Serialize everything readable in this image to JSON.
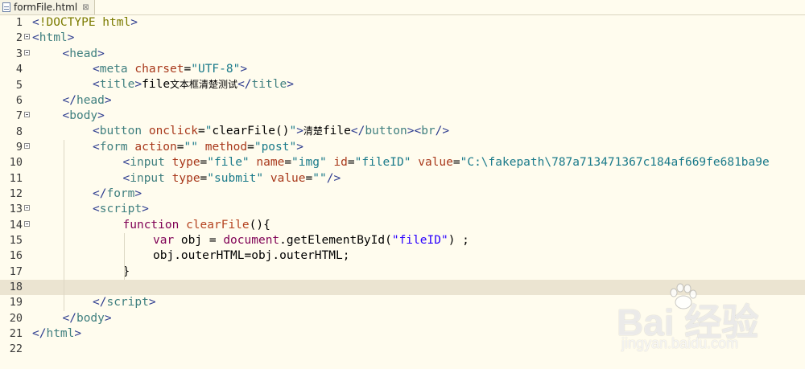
{
  "tab": {
    "title": "formFile.html",
    "file_icon": "html-file-icon",
    "close_icon": "close-icon"
  },
  "lines": [
    {
      "n": "1",
      "fold": false,
      "current": false,
      "indent": 0,
      "tokens": [
        [
          "tag",
          "<"
        ],
        [
          "doc",
          "!DOCTYPE html"
        ],
        [
          "tag",
          ">"
        ]
      ]
    },
    {
      "n": "2",
      "fold": true,
      "current": false,
      "indent": 0,
      "tokens": [
        [
          "tag",
          "<"
        ],
        [
          "tagname",
          "html"
        ],
        [
          "tag",
          ">"
        ]
      ]
    },
    {
      "n": "3",
      "fold": true,
      "current": false,
      "indent": 1,
      "tokens": [
        [
          "tag",
          "<"
        ],
        [
          "tagname",
          "head"
        ],
        [
          "tag",
          ">"
        ]
      ]
    },
    {
      "n": "4",
      "fold": false,
      "current": false,
      "indent": 2,
      "tokens": [
        [
          "tag",
          "<"
        ],
        [
          "tagname",
          "meta "
        ],
        [
          "attr",
          "charset"
        ],
        [
          "text",
          "="
        ],
        [
          "str",
          "\"UTF-8\""
        ],
        [
          "tag",
          ">"
        ]
      ]
    },
    {
      "n": "5",
      "fold": false,
      "current": false,
      "indent": 2,
      "tokens": [
        [
          "tag",
          "<"
        ],
        [
          "tagname",
          "title"
        ],
        [
          "tag",
          ">"
        ],
        [
          "text",
          "file"
        ],
        [
          "cjk",
          "文本框清楚测试"
        ],
        [
          "tag",
          "</"
        ],
        [
          "tagname",
          "title"
        ],
        [
          "tag",
          ">"
        ]
      ]
    },
    {
      "n": "6",
      "fold": false,
      "current": false,
      "indent": 1,
      "tokens": [
        [
          "tag",
          "</"
        ],
        [
          "tagname",
          "head"
        ],
        [
          "tag",
          ">"
        ]
      ]
    },
    {
      "n": "7",
      "fold": true,
      "current": false,
      "indent": 1,
      "tokens": [
        [
          "tag",
          "<"
        ],
        [
          "tagname",
          "body"
        ],
        [
          "tag",
          ">"
        ]
      ]
    },
    {
      "n": "8",
      "fold": false,
      "current": false,
      "indent": 2,
      "tokens": [
        [
          "tag",
          "<"
        ],
        [
          "tagname",
          "button "
        ],
        [
          "attr",
          "onclick"
        ],
        [
          "text",
          "="
        ],
        [
          "str",
          "\""
        ],
        [
          "js",
          "clearFile()"
        ],
        [
          "str",
          "\""
        ],
        [
          "tag",
          ">"
        ],
        [
          "cjk",
          "清楚"
        ],
        [
          "text",
          "file"
        ],
        [
          "tag",
          "</"
        ],
        [
          "tagname",
          "button"
        ],
        [
          "tag",
          "><"
        ],
        [
          "tagname",
          "br"
        ],
        [
          "tag",
          "/>"
        ]
      ]
    },
    {
      "n": "9",
      "fold": true,
      "current": false,
      "indent": 2,
      "tokens": [
        [
          "tag",
          "<"
        ],
        [
          "tagname",
          "form "
        ],
        [
          "attr",
          "action"
        ],
        [
          "text",
          "="
        ],
        [
          "str",
          "\"\" "
        ],
        [
          "attr",
          "method"
        ],
        [
          "text",
          "="
        ],
        [
          "str",
          "\"post\""
        ],
        [
          "tag",
          ">"
        ]
      ]
    },
    {
      "n": "10",
      "fold": false,
      "current": false,
      "indent": 3,
      "tokens": [
        [
          "tag",
          "<"
        ],
        [
          "tagname",
          "input "
        ],
        [
          "attr",
          "type"
        ],
        [
          "text",
          "="
        ],
        [
          "str",
          "\"file\" "
        ],
        [
          "attr",
          "name"
        ],
        [
          "text",
          "="
        ],
        [
          "str",
          "\"img\" "
        ],
        [
          "attr",
          "id"
        ],
        [
          "text",
          "="
        ],
        [
          "str",
          "\"fileID\" "
        ],
        [
          "attr",
          "value"
        ],
        [
          "text",
          "="
        ],
        [
          "str",
          "\"C:\\fakepath\\787a713471367c184af669fe681ba9e"
        ]
      ]
    },
    {
      "n": "11",
      "fold": false,
      "current": false,
      "indent": 3,
      "tokens": [
        [
          "tag",
          "<"
        ],
        [
          "tagname",
          "input "
        ],
        [
          "attr",
          "type"
        ],
        [
          "text",
          "="
        ],
        [
          "str",
          "\"submit\" "
        ],
        [
          "attr",
          "value"
        ],
        [
          "text",
          "="
        ],
        [
          "str",
          "\"\""
        ],
        [
          "tag",
          "/>"
        ]
      ]
    },
    {
      "n": "12",
      "fold": false,
      "current": false,
      "indent": 2,
      "tokens": [
        [
          "tag",
          "</"
        ],
        [
          "tagname",
          "form"
        ],
        [
          "tag",
          ">"
        ]
      ]
    },
    {
      "n": "13",
      "fold": true,
      "current": false,
      "indent": 2,
      "tokens": [
        [
          "tag",
          "<"
        ],
        [
          "tagname",
          "script"
        ],
        [
          "tag",
          ">"
        ]
      ]
    },
    {
      "n": "14",
      "fold": true,
      "current": false,
      "indent": 3,
      "tokens": [
        [
          "kw",
          "function "
        ],
        [
          "fn",
          "clearFile"
        ],
        [
          "js",
          "(){"
        ]
      ]
    },
    {
      "n": "15",
      "fold": false,
      "current": false,
      "indent": 4,
      "tokens": [
        [
          "kw",
          "var "
        ],
        [
          "js",
          "obj = "
        ],
        [
          "kw",
          "document"
        ],
        [
          "js",
          "."
        ],
        [
          "js",
          "getElementById("
        ],
        [
          "jsstr",
          "\"fileID\""
        ],
        [
          "js",
          ") ;"
        ]
      ]
    },
    {
      "n": "16",
      "fold": false,
      "current": false,
      "indent": 4,
      "tokens": [
        [
          "js",
          "obj.outerHTML=obj.outerHTML;"
        ]
      ]
    },
    {
      "n": "17",
      "fold": false,
      "current": false,
      "indent": 3,
      "tokens": [
        [
          "js",
          "}"
        ]
      ]
    },
    {
      "n": "18",
      "fold": false,
      "current": true,
      "indent": 0,
      "tokens": []
    },
    {
      "n": "19",
      "fold": false,
      "current": false,
      "indent": 2,
      "tokens": [
        [
          "tag",
          "</"
        ],
        [
          "tagname",
          "script"
        ],
        [
          "tag",
          ">"
        ]
      ]
    },
    {
      "n": "20",
      "fold": false,
      "current": false,
      "indent": 1,
      "tokens": [
        [
          "tag",
          "</"
        ],
        [
          "tagname",
          "body"
        ],
        [
          "tag",
          ">"
        ]
      ]
    },
    {
      "n": "21",
      "fold": false,
      "current": false,
      "indent": 0,
      "tokens": [
        [
          "tag",
          "</"
        ],
        [
          "tagname",
          "html"
        ],
        [
          "tag",
          ">"
        ]
      ]
    },
    {
      "n": "22",
      "fold": false,
      "current": false,
      "indent": 0,
      "tokens": []
    }
  ],
  "watermark": {
    "brand": "Bai  经验",
    "url": "jingyan.baidu.com"
  }
}
